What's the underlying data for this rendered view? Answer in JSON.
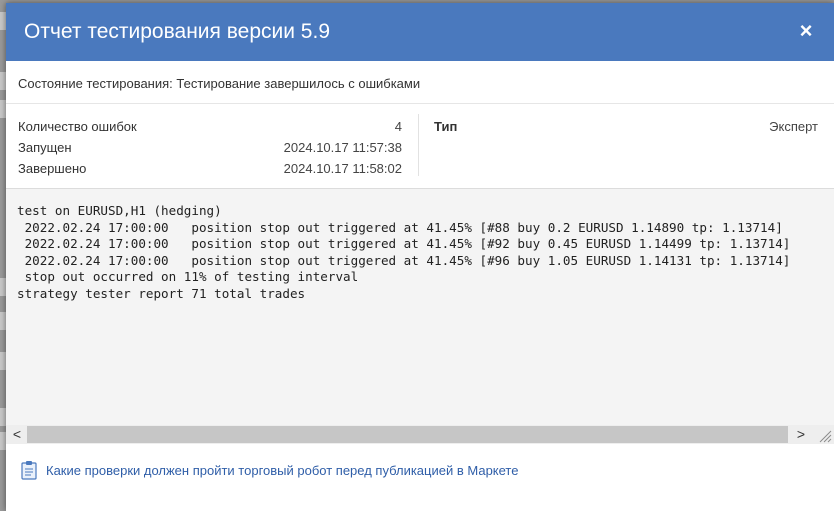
{
  "dialog": {
    "title": "Отчет тестирования версии 5.9",
    "close_label": "×"
  },
  "status": {
    "text": "Состояние тестирования: Тестирование завершилось с ошибками"
  },
  "info": {
    "rows": [
      {
        "label": "Количество ошибок",
        "value": "4"
      },
      {
        "label": "Запущен",
        "value": "2024.10.17 11:57:38"
      },
      {
        "label": "Завершено",
        "value": "2024.10.17 11:58:02"
      }
    ],
    "type_label": "Тип",
    "type_value": "Эксперт"
  },
  "log": {
    "lines": [
      "test on EURUSD,H1 (hedging)",
      " 2022.02.24 17:00:00   position stop out triggered at 41.45% [#88 buy 0.2 EURUSD 1.14890 tp: 1.13714]",
      " 2022.02.24 17:00:00   position stop out triggered at 41.45% [#92 buy 0.45 EURUSD 1.14499 tp: 1.13714]",
      " 2022.02.24 17:00:00   position stop out triggered at 41.45% [#96 buy 1.05 EURUSD 1.14131 tp: 1.13714]",
      " stop out occurred on 11% of testing interval",
      "strategy tester report 71 total trades"
    ],
    "scroll_left": "<",
    "scroll_right": ">"
  },
  "footer": {
    "link_text": "Какие проверки должен пройти торговый робот перед публикацией в Маркете",
    "icon": "clipboard-document-icon"
  },
  "colors": {
    "titlebar": "#4a79be",
    "link": "#2f5ea8",
    "log_background": "#f4f4f4"
  }
}
